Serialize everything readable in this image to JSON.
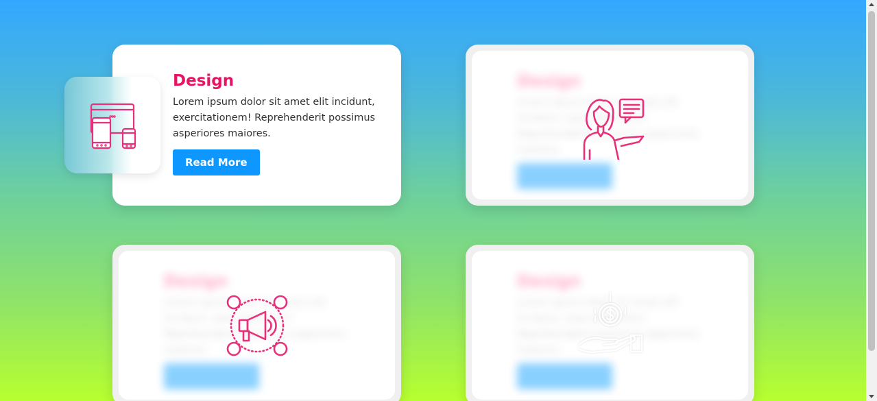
{
  "colors": {
    "accent": "#ea1264",
    "button": "#0d97ff",
    "gradient_top": "#33a8ff",
    "gradient_bottom": "#b7ff2e"
  },
  "cards": [
    {
      "icon": "devices-icon",
      "title": "Design",
      "text": "Lorem ipsum dolor sit amet elit incidunt, exercitationem! Reprehenderit possimus asperiores maiores.",
      "button": "Read More"
    },
    {
      "icon": "support-agent-icon",
      "title": "Design",
      "text": "Lorem ipsum dolor sit amet elit incidunt, exercitationem! Reprehenderit possimus asperiores maiores.",
      "button": "Read More"
    },
    {
      "icon": "megaphone-network-icon",
      "title": "Design",
      "text": "Lorem ipsum dolor sit amet elit incidunt, exercitationem! Reprehenderit possimus asperiores maiores.",
      "button": "Read More"
    },
    {
      "icon": "money-hand-icon",
      "title": "Design",
      "text": "Lorem ipsum dolor sit amet elit incidunt, exercitationem! Reprehenderit possimus asperiores maiores.",
      "button": "Read More"
    }
  ]
}
